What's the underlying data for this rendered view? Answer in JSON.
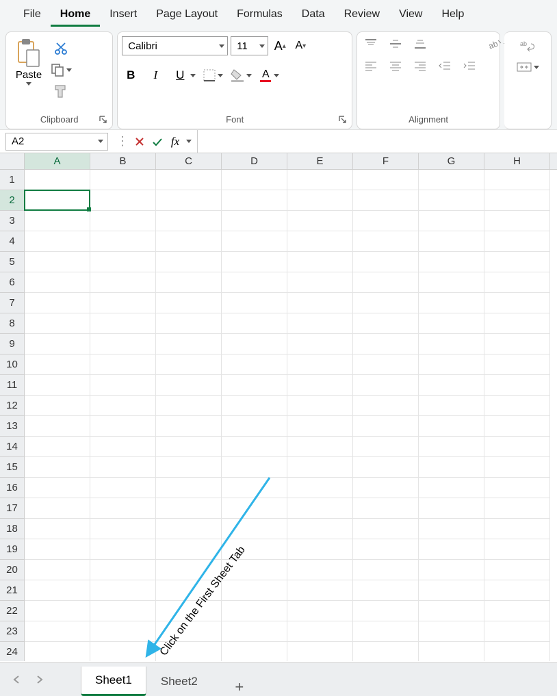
{
  "menu": {
    "items": [
      "File",
      "Home",
      "Insert",
      "Page Layout",
      "Formulas",
      "Data",
      "Review",
      "View",
      "Help"
    ],
    "active": "Home"
  },
  "ribbon": {
    "clipboard": {
      "label": "Clipboard",
      "paste": "Paste"
    },
    "font": {
      "label": "Font",
      "name": "Calibri",
      "size": "11"
    },
    "alignment": {
      "label": "Alignment"
    }
  },
  "formula_bar": {
    "cell_ref": "A2",
    "formula": ""
  },
  "grid": {
    "columns": [
      "A",
      "B",
      "C",
      "D",
      "E",
      "F",
      "G",
      "H"
    ],
    "rows": [
      "1",
      "2",
      "3",
      "4",
      "5",
      "6",
      "7",
      "8",
      "9",
      "10",
      "11",
      "12",
      "13",
      "14",
      "15",
      "16",
      "17",
      "18",
      "19",
      "20",
      "21",
      "22",
      "23",
      "24"
    ],
    "active_col": "A",
    "active_row": "2"
  },
  "sheets": {
    "tabs": [
      "Sheet1",
      "Sheet2"
    ],
    "active": "Sheet1"
  },
  "annotation": {
    "text": "Click on the First Sheet Tab"
  },
  "icons": {
    "plus": "+"
  }
}
